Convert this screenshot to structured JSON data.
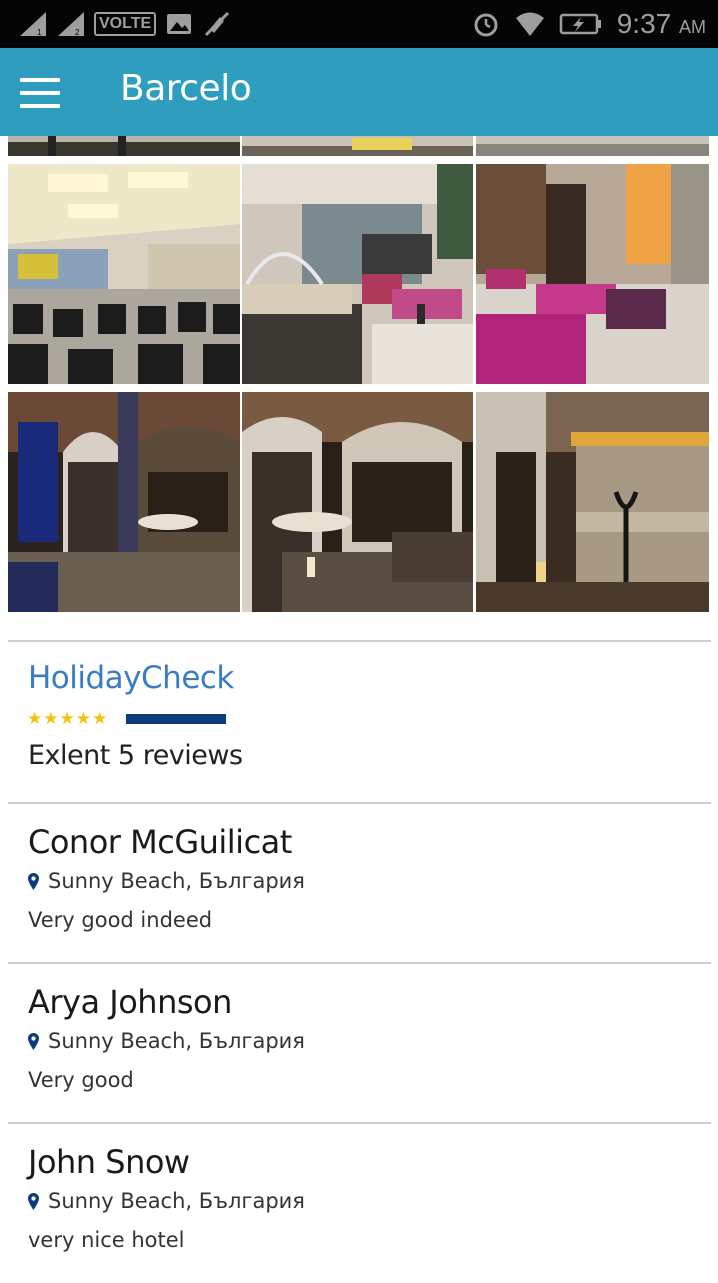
{
  "status_bar": {
    "network_label": "VOLTE",
    "time": "9:37",
    "ampm": "AM",
    "icons": [
      "signal-icon",
      "signal-icon",
      "image-icon",
      "mute-icon",
      "alarm-icon",
      "wifi-icon",
      "battery-charging-icon"
    ]
  },
  "app_bar": {
    "title": "Barcelo",
    "menu_icon": "hamburger-menu-icon",
    "color": "#2e9dbe"
  },
  "gallery": {
    "rows": [
      [
        "conference-hall",
        "restaurant-buffet",
        "restaurant-pink"
      ],
      [
        "spa-hall-blue",
        "spa-hall-candle",
        "spa-corridor"
      ]
    ]
  },
  "rating": {
    "source": "HolidayCheck",
    "stars": "★★★★★",
    "score_fraction": 1.0,
    "summary": "Exlent 5 reviews",
    "star_color": "#f5c211",
    "bar_color": "#0d3b7e"
  },
  "reviews": [
    {
      "name": "Conor McGuilicat",
      "location": "Sunny Beach, България",
      "comment": "Very good indeed"
    },
    {
      "name": "Arya Johnson",
      "location": "Sunny Beach, България",
      "comment": "Very good"
    },
    {
      "name": "John Snow",
      "location": "Sunny Beach, България",
      "comment": "very nice hotel"
    }
  ]
}
